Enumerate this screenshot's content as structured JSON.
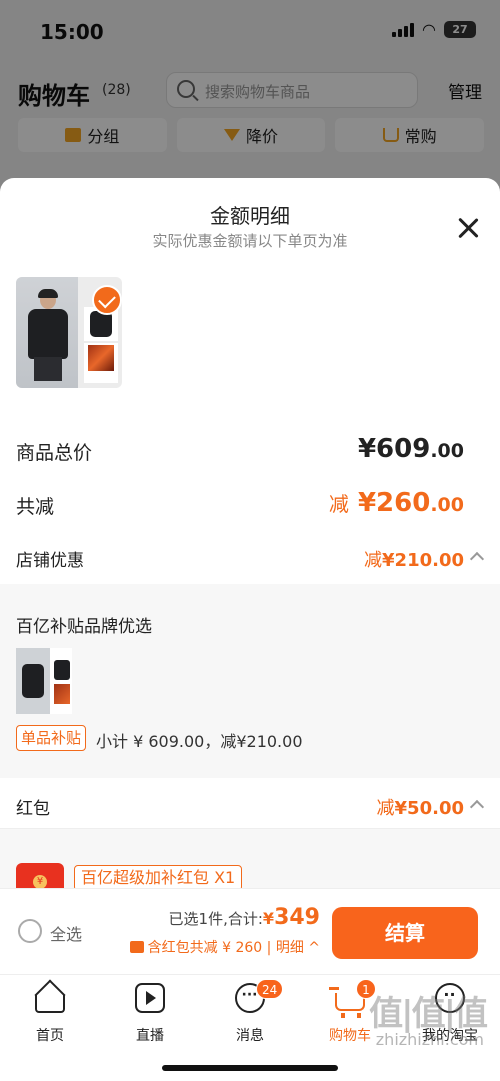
{
  "status_bar": {
    "time": "15:00",
    "battery": "27"
  },
  "cart_page": {
    "title": "购物车",
    "count": "(28)",
    "search_placeholder": "搜索购物车商品",
    "manage_label": "管理",
    "filters": [
      "分组",
      "降价",
      "常购"
    ]
  },
  "sheet": {
    "title": "金额明细",
    "subtitle": "实际优惠金额请以下单页为准",
    "total_label": "商品总价",
    "total_int": "¥609",
    "total_dec": ".00",
    "reduce_label": "共减",
    "reduce_prefix": "减",
    "reduce_int": "¥260",
    "reduce_dec": ".00",
    "shop_label": "店铺优惠",
    "shop_prefix": "减",
    "shop_value": "¥210.00",
    "subsidy_title": "百亿补贴品牌优选",
    "subsidy_tag": "单品补贴",
    "subsidy_text": "小计 ¥ 609.00，减¥210.00",
    "hongbao_label": "红包",
    "hongbao_prefix": "减",
    "hongbao_value": "¥50.00",
    "hongbao_tag": "百亿超级加补红包 X1"
  },
  "checkout": {
    "select_all": "全选",
    "selected_text": "已选1件,合计:",
    "yen": "¥",
    "price": "349",
    "discount_text": "含红包共减 ¥ 260 | 明细 ^",
    "button": "结算"
  },
  "tabs": [
    {
      "label": "首页"
    },
    {
      "label": "直播"
    },
    {
      "label": "消息",
      "badge": "24"
    },
    {
      "label": "购物车",
      "badge": "1"
    },
    {
      "label": "我的淘宝"
    }
  ],
  "watermark": {
    "glyphs": "值|值|值",
    "url": "zhizhizhi.com"
  },
  "colors": {
    "accent": "#f26a1b",
    "button": "#f8641c"
  }
}
